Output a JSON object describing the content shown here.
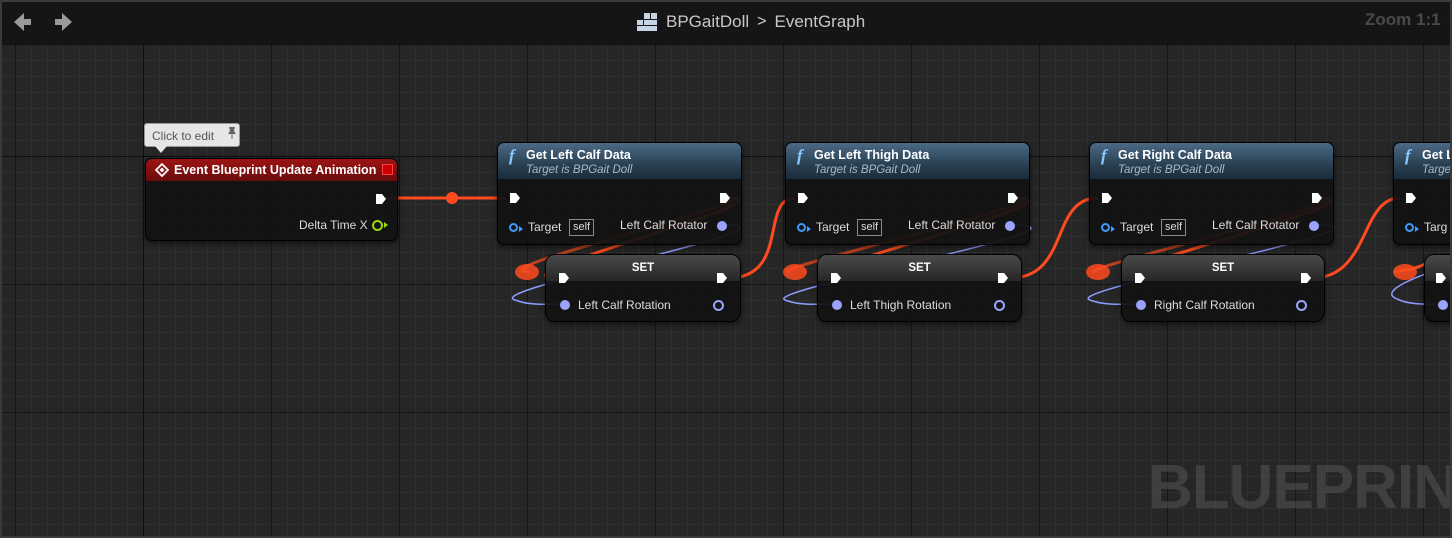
{
  "breadcrumb": {
    "blueprint": "BPGaitDoll",
    "separator": ">",
    "graph": "EventGraph"
  },
  "zoom_label": "Zoom 1:1",
  "watermark": "BLUEPRINT",
  "tooltip": {
    "label": "Click to edit"
  },
  "event_node": {
    "title": "Event Blueprint Update Animation",
    "output_pin": "Delta Time X"
  },
  "func_nodes": [
    {
      "title": "Get Left Calf Data",
      "subtitle": "Target is BPGait Doll",
      "target_label": "Target",
      "target_value": "self",
      "output_label": "Left Calf Rotator"
    },
    {
      "title": "Get Left Thigh Data",
      "subtitle": "Target is BPGait Doll",
      "target_label": "Target",
      "target_value": "self",
      "output_label": "Left Calf Rotator"
    },
    {
      "title": "Get Right Calf Data",
      "subtitle": "Target is BPGait Doll",
      "target_label": "Target",
      "target_value": "self",
      "output_label": "Left Calf Rotator"
    },
    {
      "title": "Get L",
      "subtitle": "Targe",
      "target_label": "Targ"
    }
  ],
  "set_nodes": [
    {
      "title": "SET",
      "input_label": "Left Calf Rotation"
    },
    {
      "title": "SET",
      "input_label": "Left Thigh Rotation"
    },
    {
      "title": "SET",
      "input_label": "Right Calf Rotation"
    }
  ],
  "colors": {
    "exec_wire": "#ff4b1f",
    "struct_wire": "#8d9cff",
    "event_header": "#9c1414",
    "func_header": "#2b4356"
  },
  "icons": {
    "back": "arrow-left-icon",
    "forward": "arrow-right-icon",
    "blueprint": "blueprint-class-icon",
    "function": "function-icon",
    "event": "event-diamond-icon"
  }
}
